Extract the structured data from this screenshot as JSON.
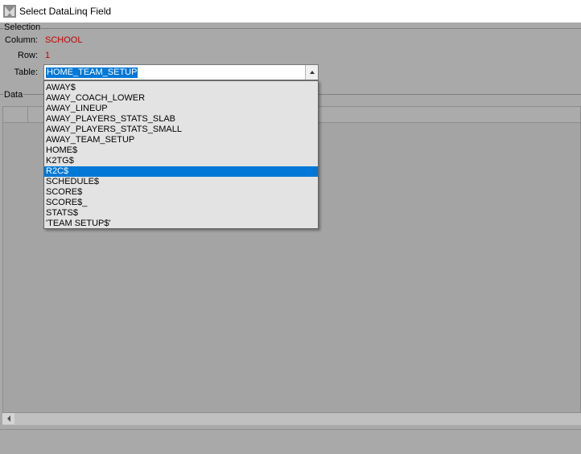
{
  "window": {
    "title": "Select DataLinq Field"
  },
  "selection": {
    "group_label": "Selection",
    "column_label": "Column:",
    "column_value": "SCHOOL",
    "row_label": "Row:",
    "row_value": "1",
    "table_label": "Table:",
    "table_value": "HOME_TEAM_SETUP"
  },
  "dropdown": {
    "items": [
      "AWAY$",
      "AWAY_COACH_LOWER",
      "AWAY_LINEUP",
      "AWAY_PLAYERS_STATS_SLAB",
      "AWAY_PLAYERS_STATS_SMALL",
      "AWAY_TEAM_SETUP",
      "HOME$",
      "K2TG$",
      "R2C$",
      "SCHEDULE$",
      "SCORE$",
      "SCORE$_",
      "STATS$",
      "'TEAM SETUP$'"
    ],
    "highlighted": "R2C$"
  },
  "data_section": {
    "group_label": "Data"
  },
  "colors": {
    "accent": "#0078d7",
    "value_text": "#c00000",
    "background": "#a9a9a9"
  }
}
